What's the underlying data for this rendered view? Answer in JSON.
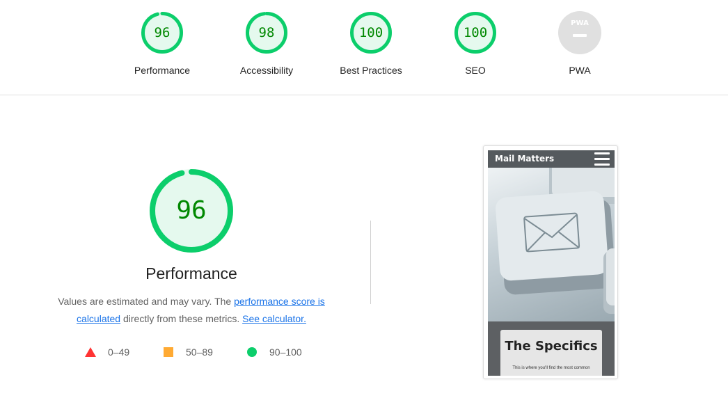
{
  "categories": [
    {
      "label": "Performance",
      "score": "96",
      "value": 96
    },
    {
      "label": "Accessibility",
      "score": "98",
      "value": 98
    },
    {
      "label": "Best Practices",
      "score": "100",
      "value": 100
    },
    {
      "label": "SEO",
      "score": "100",
      "value": 100
    },
    {
      "label": "PWA",
      "score": "",
      "value": null
    }
  ],
  "pwa_badge": {
    "logo_text": "PWA"
  },
  "main": {
    "score": "96",
    "value": 96,
    "title": "Performance",
    "desc_prefix": "Values are estimated and may vary. The ",
    "desc_link1": "performance score is calculated",
    "desc_middle": " directly from these metrics. ",
    "desc_link2": "See calculator."
  },
  "legend": [
    {
      "icon": "triangle-icon",
      "range": "0–49",
      "color": "#ff3333"
    },
    {
      "icon": "square-icon",
      "range": "50–89",
      "color": "#ffaa33"
    },
    {
      "icon": "circle-icon",
      "range": "90–100",
      "color": "#0cce6b"
    }
  ],
  "screenshot": {
    "site_name": "Mail Matters",
    "card_title": "The Specifics",
    "card_text": "This is where you'll find the most common"
  },
  "colors": {
    "pass": "#0cce6b",
    "pass_text": "#008800",
    "pass_bg": "#e5f9ee",
    "na": "#e0e0e0",
    "link": "#1a73e8"
  }
}
